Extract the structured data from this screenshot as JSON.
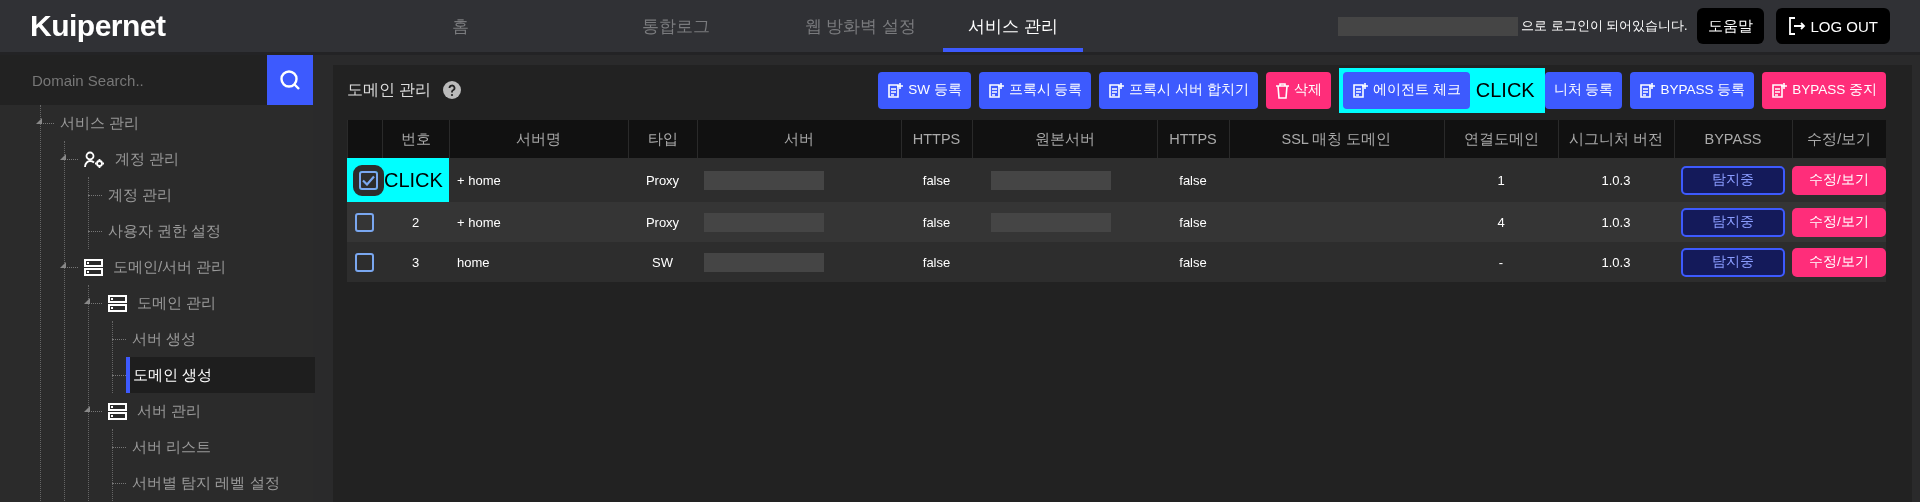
{
  "header": {
    "logo": "Kuipernet",
    "nav": [
      {
        "label": "홈",
        "selected": false
      },
      {
        "label": "통합로그",
        "selected": false
      },
      {
        "label": "웹 방화벽 설정",
        "selected": false
      },
      {
        "label": "서비스 관리",
        "selected": true
      }
    ],
    "user_redacted": true,
    "login_text": "으로 로그인이 되어있습니다.",
    "help_button": "도움말",
    "logout_button": "LOG OUT"
  },
  "sidebar": {
    "search": {
      "placeholder": "Domain Search.."
    },
    "tree": [
      {
        "label": "서비스 관리",
        "expanded": true,
        "selected": false,
        "children": [
          {
            "label": "계정 관리",
            "kind": "account",
            "expanded": true,
            "selected": false,
            "children": [
              {
                "label": "계정 관리",
                "selected": false
              },
              {
                "label": "사용자 권한 설정",
                "selected": false
              }
            ]
          },
          {
            "label": "도메인/서버 관리",
            "kind": "server",
            "expanded": true,
            "selected": false,
            "children": [
              {
                "label": "도메인 관리",
                "kind": "server",
                "expanded": true,
                "selected": false,
                "children": [
                  {
                    "label": "서버 생성",
                    "selected": false
                  },
                  {
                    "label": "도메인 생성",
                    "selected": true
                  }
                ]
              },
              {
                "label": "서버 관리",
                "kind": "server",
                "expanded": true,
                "selected": false,
                "children": [
                  {
                    "label": "서버 리스트",
                    "selected": false
                  },
                  {
                    "label": "서버별 탐지 레벨 설정",
                    "selected": false
                  }
                ]
              }
            ]
          }
        ]
      }
    ]
  },
  "main": {
    "title": "도메인 관리",
    "toolbar": [
      {
        "label": "SW 등록",
        "kind": "add",
        "color": "#3d5afe",
        "highlighted": false
      },
      {
        "label": "프록시 등록",
        "kind": "add",
        "color": "#3d5afe",
        "highlighted": false
      },
      {
        "label": "프록시 서버 합치기",
        "kind": "add",
        "color": "#3d5afe",
        "highlighted": false
      },
      {
        "label": "삭제",
        "kind": "delete",
        "color": "#ff2d7a",
        "highlighted": false
      },
      {
        "label": "에이전트 체크",
        "kind": "add",
        "color": "#3d5afe",
        "highlighted": true,
        "callout": "CLICK"
      },
      {
        "label": "니처 등록",
        "kind": "plain",
        "color": "#3d5afe",
        "highlighted": false
      },
      {
        "label": "BYPASS 등록",
        "kind": "add",
        "color": "#3d5afe",
        "highlighted": false
      },
      {
        "label": "BYPASS 중지",
        "kind": "add",
        "color": "#ff2d7a",
        "highlighted": false
      }
    ],
    "table": {
      "columns": [
        "번호",
        "서버명",
        "타입",
        "서버",
        "HTTPS",
        "원본서버",
        "HTTPS",
        "SSL 매칭 도메인",
        "연결도메인",
        "시그니처 버전",
        "BYPASS",
        "수정/보기"
      ],
      "rows": [
        {
          "checked": true,
          "callout": "CLICK",
          "name": "+ home",
          "type": "Proxy",
          "server_redacted": true,
          "https": "false",
          "origin_redacted": true,
          "origin_https": "false",
          "connected": "1",
          "signature": "1.0.3",
          "bypass": "탐지중",
          "action": "수정/보기"
        },
        {
          "checked": false,
          "no": "2",
          "name": "+ home",
          "type": "Proxy",
          "server_redacted": true,
          "https": "false",
          "origin_redacted": true,
          "origin_https": "false",
          "connected": "4",
          "signature": "1.0.3",
          "bypass": "탐지중",
          "action": "수정/보기"
        },
        {
          "checked": false,
          "no": "3",
          "name": "home",
          "type": "SW",
          "server_redacted": true,
          "https": "false",
          "origin_redacted": false,
          "origin_https": "false",
          "connected": "-",
          "signature": "1.0.3",
          "bypass": "탐지중",
          "action": "수정/보기"
        }
      ]
    }
  }
}
